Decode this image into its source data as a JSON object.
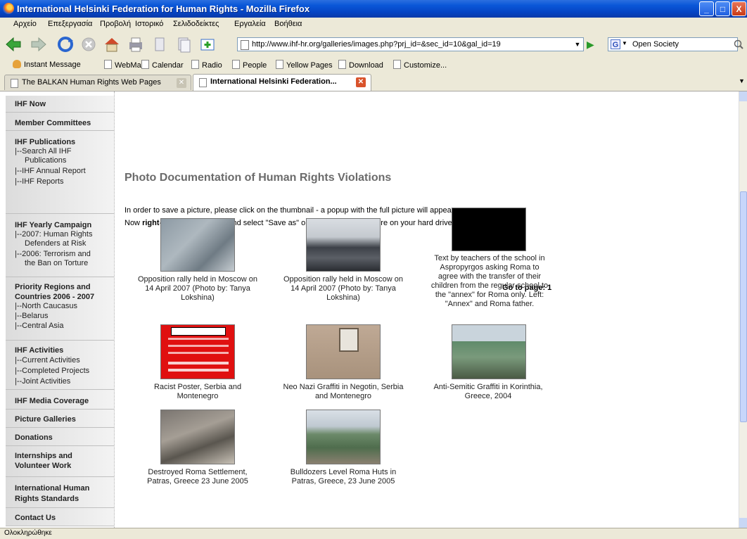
{
  "window": {
    "title": "International Helsinki Federation for Human Rights - Mozilla Firefox",
    "min": "_",
    "max": "□",
    "close": "X"
  },
  "menu": [
    "Αρχείο",
    "Επεξεργασία",
    "Προβολή",
    "Ιστορικό",
    "Σελιδοδείκτες",
    "Εργαλεία",
    "Βοήθεια"
  ],
  "navbar": {
    "url": "http://www.ihf-hr.org/galleries/images.php?prj_id=&sec_id=10&gal_id=19",
    "search_engine": "G",
    "search_value": "Open Society"
  },
  "bookmarks": [
    "Instant Message",
    "WebMail",
    "Calendar",
    "Radio",
    "People",
    "Yellow Pages",
    "Download",
    "Customize..."
  ],
  "tabs": [
    {
      "label": "The BALKAN Human Rights Web Pages"
    },
    {
      "label": "International Helsinki Federation..."
    }
  ],
  "sidebar": {
    "ihf_now": "IHF Now",
    "member_committees": "Member Committees",
    "publications": {
      "title": "IHF Publications",
      "items": [
        "|--Search All IHF",
        "Publications",
        "|--IHF Annual Report",
        "|--IHF Reports"
      ]
    },
    "yearly": {
      "title": "IHF Yearly Campaign",
      "items": [
        "|--2007: Human Rights",
        "Defenders at Risk",
        "|--2006: Terrorism and",
        "the Ban on Torture"
      ]
    },
    "priority": {
      "title1": "Priority Regions and",
      "title2": "Countries 2006 - 2007",
      "items": [
        "|--North Caucasus",
        "|--Belarus",
        "|--Central Asia"
      ]
    },
    "activities": {
      "title": "IHF Activities",
      "items": [
        "|--Current Activities",
        "|--Completed Projects",
        "|--Joint Activities"
      ]
    },
    "media": "IHF Media Coverage",
    "galleries": "Picture Galleries",
    "donations": "Donations",
    "internships1": "Internships and",
    "internships2": "Volunteer Work",
    "standards1": "International Human",
    "standards2": "Rights Standards",
    "contact": "Contact Us"
  },
  "content": {
    "title": "Photo Documentation of Human Rights Violations",
    "intro1": "In order to save a picture, please click on the thumbnail - a popup with the full picture will appear.",
    "intro2_a": "Now ",
    "intro2_b": "right",
    "intro2_c": "-click on the picture and select \"Save as\" option to save the picture on your hard drive.",
    "goto": "Go to page: 1"
  },
  "gallery": [
    {
      "caption": [
        "Opposition rally held in Moscow on",
        "14 April 2007 (Photo by: Tanya",
        "Lokshina)"
      ]
    },
    {
      "caption": [
        "Opposition rally held in Moscow on",
        "14 April 2007 (Photo by: Tanya",
        "Lokshina)"
      ]
    },
    {
      "caption": [
        "Text by teachers of the school in",
        "Aspropyrgos asking Roma to",
        "agree with the transfer of their",
        "children from the regular school to",
        "the \"annex\" for Roma only. Left:",
        "\"Annex\" and Roma father."
      ]
    },
    {
      "caption": [
        "Racist Poster, Serbia and",
        "Montenegro"
      ]
    },
    {
      "caption": [
        "Neo Nazi Graffiti in Negotin, Serbia",
        "and Montenegro"
      ]
    },
    {
      "caption": [
        "Anti-Semitic Graffiti in Korinthia,",
        "Greece, 2004"
      ]
    },
    {
      "caption": [
        "Destroyed Roma Settlement,",
        "Patras, Greece 23 June 2005"
      ]
    },
    {
      "caption": [
        "Bulldozers Level Roma Huts in",
        "Patras, Greece, 23 June 2005"
      ]
    }
  ],
  "status": "Ολοκληρώθηκε"
}
